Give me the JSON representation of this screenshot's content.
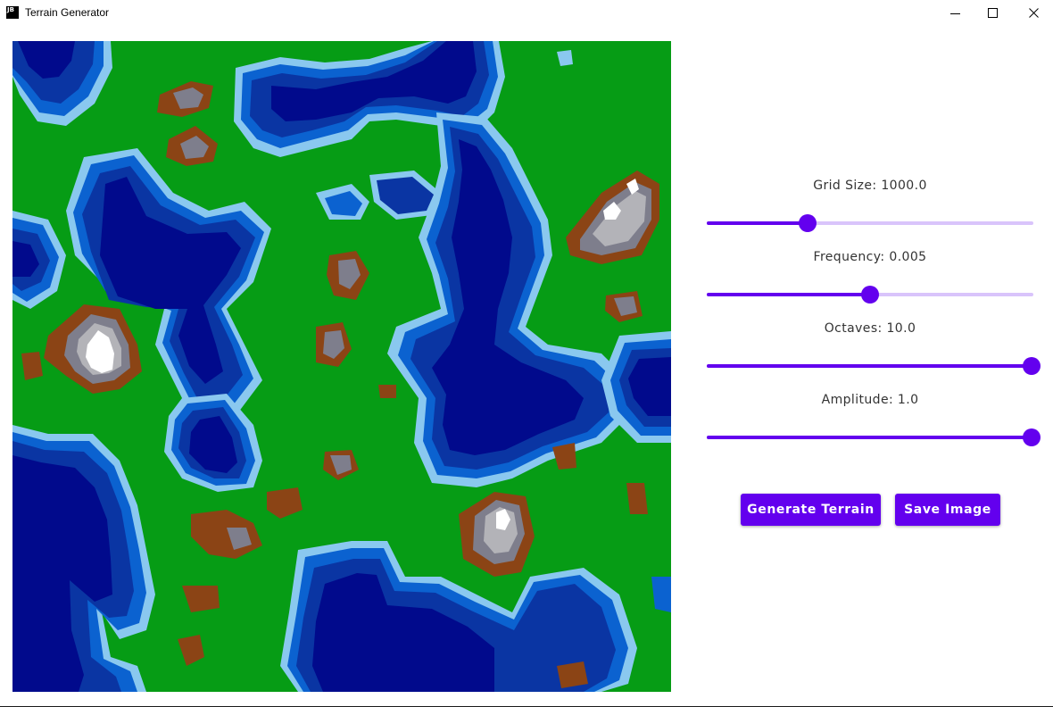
{
  "window": {
    "title": "Terrain Generator",
    "app_icon_text_top": "JB",
    "app_icon_text_bottom": "",
    "buttons": [
      "minimize-icon",
      "maximize-icon",
      "close-icon"
    ]
  },
  "terrain_map": {
    "colors": {
      "deep_water": "#010a8c",
      "water": "#0a35a3",
      "shallow_water": "#0b62d0",
      "shore": "#8ac8ef",
      "grass": "#069c15",
      "dirt": "#8b4415",
      "rock": "#7e7e8c",
      "high_rock": "#b3b3b8",
      "snow": "#ffffff"
    }
  },
  "controls": {
    "sliders": [
      {
        "label": "Grid Size: 1000.0",
        "fraction": 0.31
      },
      {
        "label": "Frequency: 0.005",
        "fraction": 0.5
      },
      {
        "label": "Octaves: 10.0",
        "fraction": 1.0
      },
      {
        "label": "Amplitude: 1.0",
        "fraction": 1.0
      }
    ],
    "generate_label": "Generate Terrain",
    "save_label": "Save Image"
  },
  "colors": {
    "accent": "#6300ee",
    "track_inactive": "#d9c4fb"
  }
}
